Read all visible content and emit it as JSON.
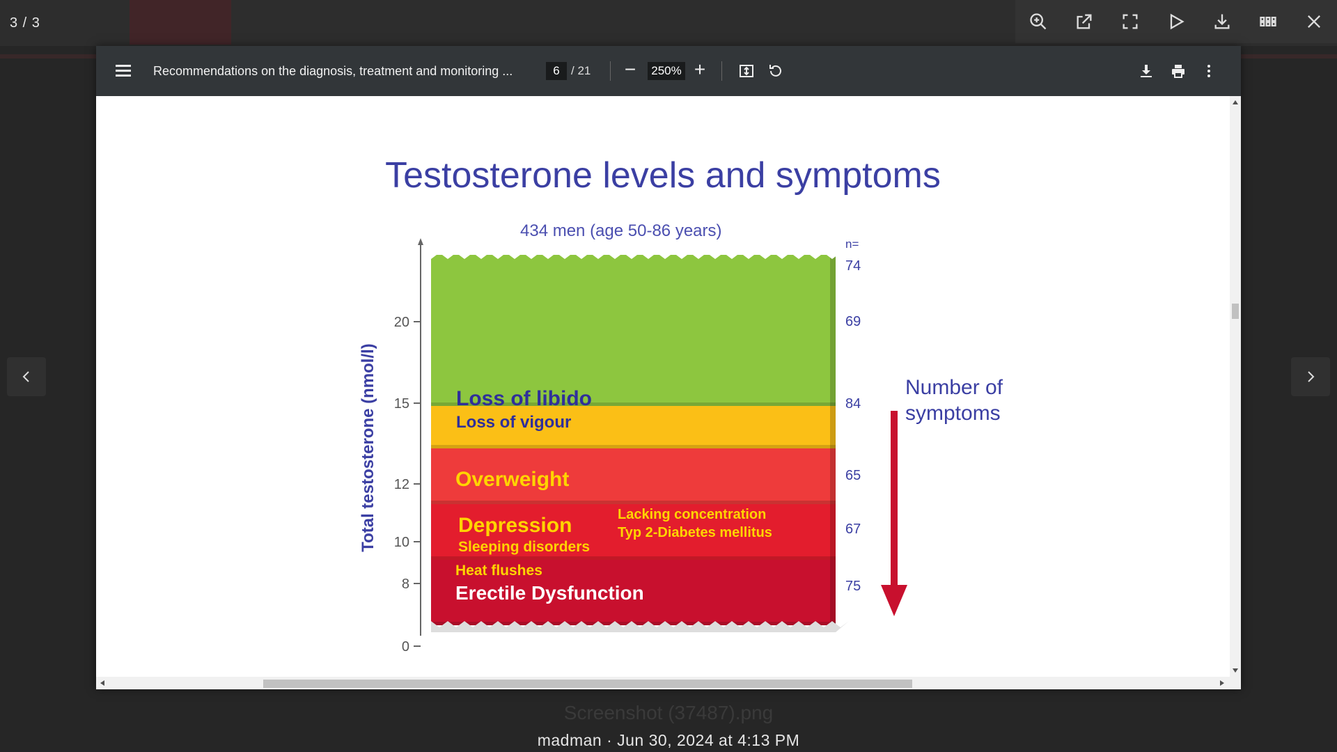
{
  "viewer": {
    "counter": "3 / 3",
    "caption_filename": "Screenshot (37487).png",
    "caption_meta": "madman · Jun 30, 2024 at 4:13 PM"
  },
  "toolbar": {
    "icons": [
      "zoom-in-icon",
      "open-external-icon",
      "fullscreen-icon",
      "play-icon",
      "download-icon",
      "grid-icon",
      "close-icon"
    ]
  },
  "pdf": {
    "title": "Recommendations on the diagnosis, treatment and monitoring ...",
    "page_current": "6",
    "page_total": "/ 21",
    "zoom": "250%"
  },
  "chart_data": {
    "type": "stacked-bands",
    "title": "Testosterone levels and symptoms",
    "subtitle": "434 men  (age 50-86 years)",
    "ylabel": "Total testosterone (nmol/l)",
    "yticks": [
      "0",
      "8",
      "10",
      "12",
      "15",
      "20"
    ],
    "n_header": "n=",
    "n_values": [
      "74",
      "69",
      "84",
      "65",
      "67",
      "75"
    ],
    "arrow_label": [
      "Number of",
      "symptoms"
    ],
    "bands": [
      {
        "from": 15,
        "to": 21,
        "color": "#8dc63f",
        "labels": []
      },
      {
        "from": 12,
        "to": 15,
        "color": "#fbbf16",
        "labels": [
          "Loss of libido",
          "Loss of vigour"
        ]
      },
      {
        "from": 10,
        "to": 12,
        "color": "#ee3b3b",
        "labels": [
          "Overweight"
        ]
      },
      {
        "from": 8,
        "to": 10,
        "color": "#e31d2d",
        "labels": [
          "Depression",
          "Sleeping disorders",
          "Lacking concentration",
          "Typ 2-Diabetes mellitus"
        ]
      },
      {
        "from": 0,
        "to": 8,
        "color": "#c8102e",
        "labels": [
          "Heat flushes",
          "Erectile Dysfunction"
        ]
      }
    ],
    "colors": {
      "axis_text": "#3b3fa3",
      "band_text_dark": "#2f2f9a",
      "band_text_light": "#ffd400",
      "arrow": "#c8102e"
    }
  }
}
